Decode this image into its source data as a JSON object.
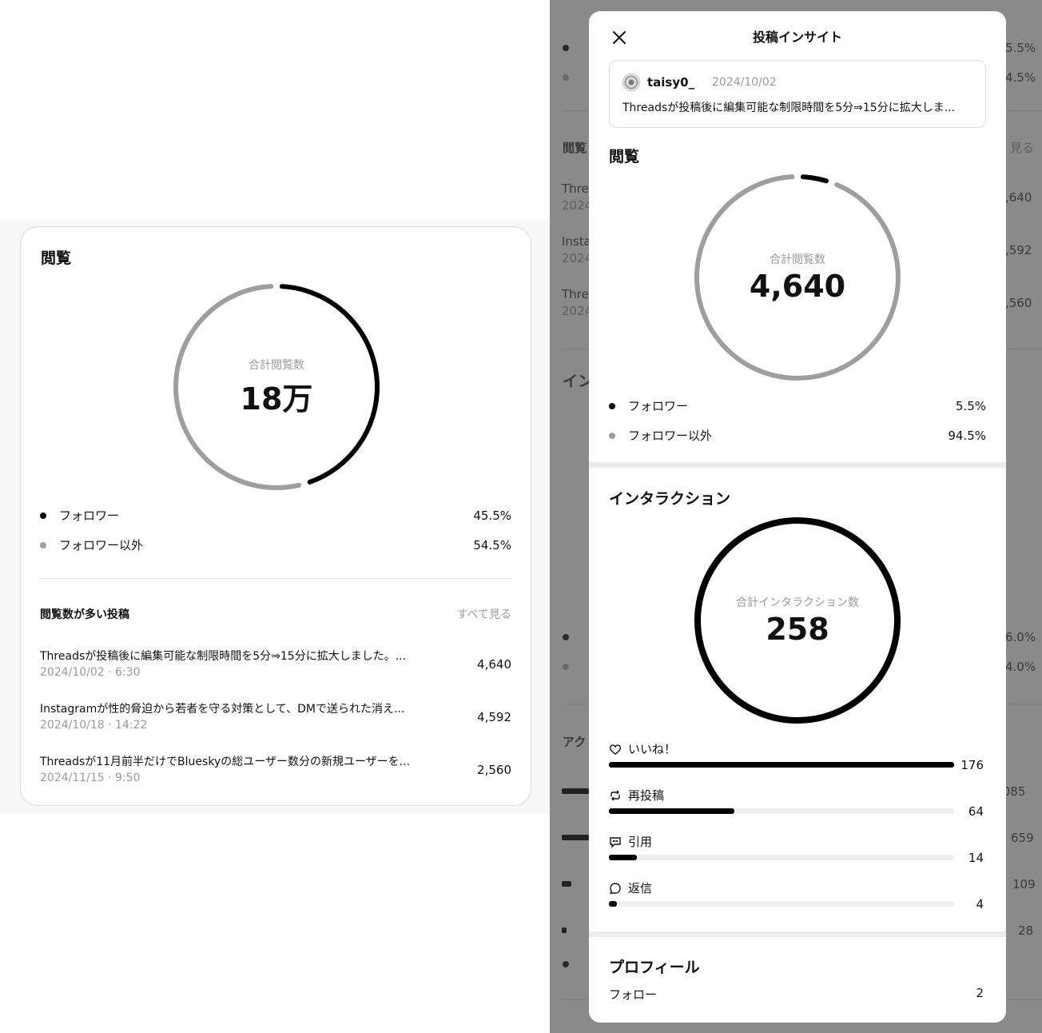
{
  "left_card": {
    "title": "閲覧",
    "donut": {
      "label": "合計閲覧数",
      "value": "18万",
      "follower_fraction": 0.455
    },
    "legend": [
      {
        "label": "フォロワー",
        "pct": "45.5%",
        "color": "#000000"
      },
      {
        "label": "フォロワー以外",
        "pct": "54.5%",
        "color": "#9e9e9e"
      }
    ],
    "top_posts": {
      "title": "閲覧数が多い投稿",
      "see_all": "すべて見る",
      "items": [
        {
          "text": "Threadsが投稿後に編集可能な制限時間を5分⇒15分に拡大しました。...",
          "date": "2024/10/02 · 6:30",
          "views": "4,640"
        },
        {
          "text": "Instagramが性的脅迫から若者を守る対策として、DMで送られた消え...",
          "date": "2024/10/18 · 14:22",
          "views": "4,592"
        },
        {
          "text": "Threadsが11月前半だけでBlueskyの総ユーザー数分の新規ユーザーを...",
          "date": "2024/11/15 · 9:50",
          "views": "2,560"
        }
      ]
    }
  },
  "background_page": {
    "views_title": "閲覧",
    "pcts_top": [
      "5.5%",
      "4.5%"
    ],
    "see_all_partial": "見る",
    "posts": [
      {
        "title_partial": "Threa",
        "date_partial": "2024",
        "value_partial": ",640"
      },
      {
        "title_partial": "Insta",
        "date_partial": "2024",
        "value_partial": ",592"
      },
      {
        "title_partial": "Threa",
        "date_partial": "2024",
        "value_partial": ",560"
      }
    ],
    "interaction_partial": "イン",
    "pcts_mid": [
      "6.0%",
      "4.0%"
    ],
    "actions_partial": "アク",
    "action_values": [
      ",085",
      "659",
      "109",
      "28"
    ]
  },
  "modal": {
    "title": "投稿インサイト",
    "post": {
      "username": "taisy0_",
      "date": "2024/10/02",
      "text": "Threadsが投稿後に編集可能な制限時間を5分⇒15分に拡大しま..."
    },
    "views": {
      "title": "閲覧",
      "label": "合計閲覧数",
      "value": "4,640",
      "follower_fraction": 0.055,
      "legend": [
        {
          "label": "フォロワー",
          "pct": "5.5%",
          "color": "#000000"
        },
        {
          "label": "フォロワー以外",
          "pct": "94.5%",
          "color": "#9e9e9e"
        }
      ]
    },
    "interactions": {
      "title": "インタラクション",
      "label": "合計インタラクション数",
      "value": "258",
      "items": [
        {
          "label": "いいね！",
          "icon": "heart-icon",
          "value": "176",
          "fraction": 1.0
        },
        {
          "label": "再投稿",
          "icon": "repost-icon",
          "value": "64",
          "fraction": 0.364
        },
        {
          "label": "引用",
          "icon": "quote-icon",
          "value": "14",
          "fraction": 0.08
        },
        {
          "label": "返信",
          "icon": "reply-icon",
          "value": "4",
          "fraction": 0.023
        }
      ]
    },
    "profile": {
      "title": "プロフィール",
      "rows": [
        {
          "label": "フォロー",
          "value": "2"
        }
      ]
    }
  }
}
